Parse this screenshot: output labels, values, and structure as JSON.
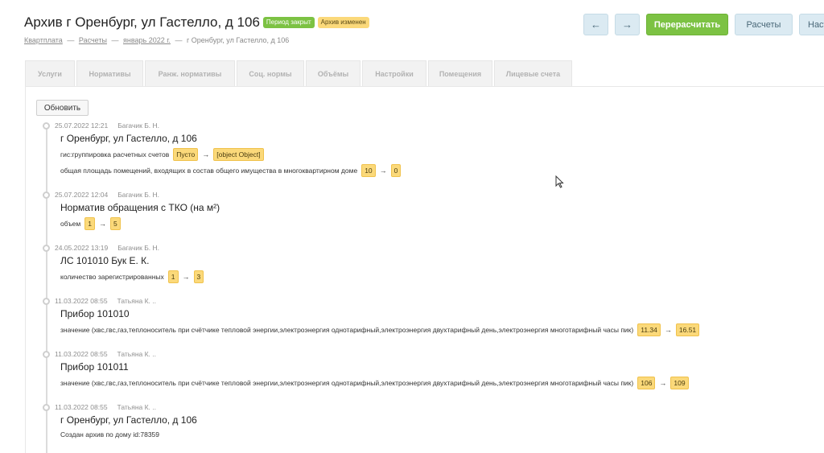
{
  "header": {
    "title": "Архив г Оренбург, ул Гастелло, д 106",
    "badge_closed": "Период закрыт",
    "badge_changed": "Архив изменен",
    "breadcrumb": {
      "items": [
        "Квартплата",
        "Расчеты",
        "январь 2022 г."
      ],
      "last": "г Оренбург, ул Гастелло, д 106",
      "separator": "—"
    }
  },
  "toolbar": {
    "back": "←",
    "forward": "→",
    "recalc": "Перерасчитать",
    "calcs": "Расчеты",
    "settings": "Настр"
  },
  "tabs": [
    {
      "label": "Услуги"
    },
    {
      "label": "Нормативы"
    },
    {
      "label": "Ранж. нормативы"
    },
    {
      "label": "Соц. нормы"
    },
    {
      "label": "Объёмы"
    },
    {
      "label": "Настройки"
    },
    {
      "label": "Помещения"
    },
    {
      "label": "Лицевые счета"
    }
  ],
  "refresh_label": "Обновить",
  "entries": [
    {
      "date": "25.07.2022 12:21",
      "author": "Багачик Б. Н.",
      "title": "г Оренбург, ул Гастелло, д 106",
      "changes": [
        {
          "label": "гис:группировка расчетных счетов",
          "from": "Пусто",
          "to": "[object Object]"
        },
        {
          "label": "общая площадь помещений, входящих в состав общего имущества в многоквартирном доме",
          "from": "10",
          "to": "0"
        }
      ]
    },
    {
      "date": "25.07.2022 12:04",
      "author": "Багачик Б. Н.",
      "title": "Норматив обращения с ТКО (на м²)",
      "changes": [
        {
          "label": "объем",
          "from": "1",
          "to": "5"
        }
      ]
    },
    {
      "date": "24.05.2022 13:19",
      "author": "Багачик Б. Н.",
      "title": "ЛС 101010 Бук Е. К.",
      "changes": [
        {
          "label": "количество зарегистрированных",
          "from": "1",
          "to": "3"
        }
      ]
    },
    {
      "date": "11.03.2022 08:55",
      "author": "Татьяна К. ..",
      "title": "Прибор 101010",
      "changes": [
        {
          "label": "значение (хвс,гвс,газ,теплоноситель при счётчике тепловой энергии,электроэнергия однотарифный,электроэнергия двухтарифный день,электроэнергия многотарифный часы пик)",
          "from": "11.34",
          "to": "16.51"
        }
      ]
    },
    {
      "date": "11.03.2022 08:55",
      "author": "Татьяна К. ..",
      "title": "Прибор 101011",
      "changes": [
        {
          "label": "значение (хвс,гвс,газ,теплоноситель при счётчике тепловой энергии,электроэнергия однотарифный,электроэнергия двухтарифный день,электроэнергия многотарифный часы пик)",
          "from": "106",
          "to": "109"
        }
      ]
    },
    {
      "date": "11.03.2022 08:55",
      "author": "Татьяна К. ..",
      "title": "г Оренбург, ул Гастелло, д 106",
      "note": "Создан архив по дому id:78359"
    }
  ],
  "arrow_symbol": "→",
  "colors": {
    "primary": "#7cc243",
    "chip": "#fbd97a",
    "button": "#dbeaf2"
  }
}
